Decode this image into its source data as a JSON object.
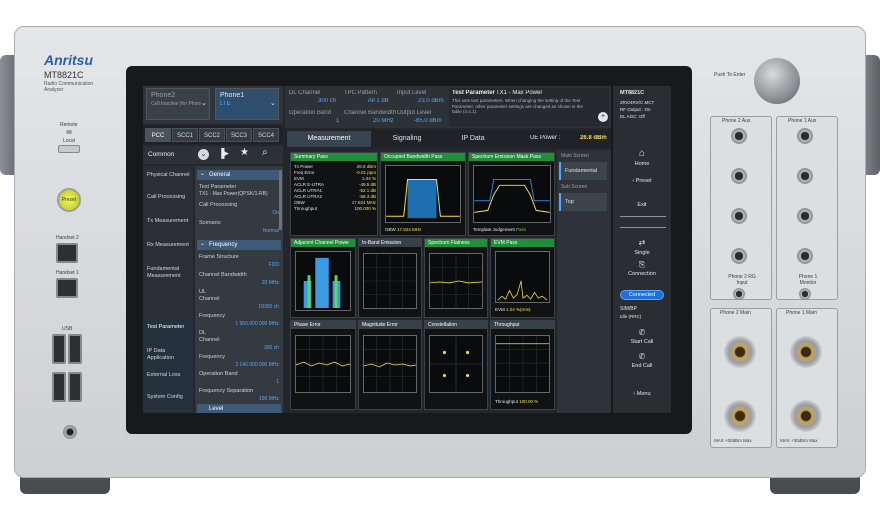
{
  "brand": {
    "logo": "Anritsu",
    "model": "MT8821C",
    "subtitle": "Radio Communication Analyzer"
  },
  "front_left": {
    "remote": "Remote",
    "local": "Local",
    "preset": "Preset",
    "handset2": "Handset 2",
    "handset1": "Handset 1",
    "usb": "USB"
  },
  "phones": {
    "phone2": "Phone2",
    "phone2_sub": "Cell Inactive (for Phone1)",
    "phone1": "Phone1",
    "phone1_sub": "LTE"
  },
  "cc_tabs": [
    "PCC",
    "SCC1",
    "SCC2",
    "SCC3",
    "SCC4"
  ],
  "common_label": "Common",
  "nav": [
    "Physical Channel",
    "Call Processing",
    "Tx Measurement",
    "Rx Measurement",
    "Fundamental Measurement",
    "Test Parameter",
    "IP Data Application",
    "External Loss",
    "System Config"
  ],
  "params": {
    "general": "General",
    "test_param": "Test Parameter",
    "test_param_val": "TX1 - Max Power(QPSK/1-RB)",
    "call_proc": "Call Processing",
    "call_proc_val": "On",
    "scenario": "Scenario",
    "scenario_val": "Normal",
    "frequency": "Frequency",
    "frame": "Frame Structure",
    "frame_val": "FDD",
    "bw": "Channel Bandwidth",
    "bw_val": "20 MHz",
    "ul": "UL",
    "channel": "Channel",
    "ul_ch_val": "18300 ch",
    "ul_freq": "Frequency",
    "ul_freq_val": "1 950.000 000 MHz",
    "dl": "DL",
    "dl_channel": "Channel",
    "dl_ch_val": "300 ch",
    "dl_freq": "Frequency",
    "dl_freq_val": "2 140.000 000 MHz",
    "op_band": "Operation Band",
    "op_band_val": "1",
    "freq_sep": "Frequency Separation",
    "freq_sep_val": "190 MHz",
    "level": "Level"
  },
  "info": {
    "dl_channel": "DL Channel",
    "dl_channel_val": "300 ch",
    "tpc": "TPC Pattern",
    "tpc_val": "All 1 dB",
    "input_level": "Input Level",
    "input_level_val": "23.0 dBm",
    "op_band": "Operation Band",
    "op_band_val": "1",
    "ch_bw": "Channel Bandwidth",
    "ch_bw_val": "20 MHz",
    "out_level": "Output Level",
    "out_level_val": "-85.0 dBm",
    "tp_title": "Test Parameter",
    "tp_val": "TX1 - Max Power",
    "tp_note": "This sets test parameters. When changing the setting of the Test Parameter, other parameter settings are changed as shown in the table (4.4.1)."
  },
  "main_tabs": [
    "Measurement",
    "Signaling",
    "IP Data"
  ],
  "ue_power": {
    "label": "UE Power :",
    "value": "26.8 dBm"
  },
  "panels": [
    {
      "title": "Summary",
      "hdr": "Pass"
    },
    {
      "title": "Occupied Bandwidth",
      "hdr": "Pass"
    },
    {
      "title": "Spectrum Emission Mask",
      "hdr": "Pass"
    },
    {
      "title": "Adjacent Channel Power",
      "hdr": "Pass"
    },
    {
      "title": "In-Band Emission",
      "hdr": ""
    },
    {
      "title": "Spectrum Flatness",
      "hdr": "Pass"
    },
    {
      "title": "EVM",
      "hdr": "Pass"
    },
    {
      "title": "Phase Error",
      "hdr": ""
    },
    {
      "title": "Magnitude Error",
      "hdr": ""
    },
    {
      "title": "Constellation",
      "hdr": ""
    },
    {
      "title": "Throughput",
      "hdr": ""
    }
  ],
  "summary_rows": [
    {
      "k": "Tx Power",
      "v": "26.8",
      "u": "dBm"
    },
    {
      "k": "Freq Error",
      "v": "-0.01",
      "u": "ppm"
    },
    {
      "k": "EVM",
      "v": "1.04",
      "u": "%"
    },
    {
      "k": "ACLR E-UTRA",
      "v": "-49.5",
      "u": "dB"
    },
    {
      "k": "ACLR UTRA1",
      "v": "-52.1",
      "u": "dB"
    },
    {
      "k": "ACLR UTRA2",
      "v": "-58.3",
      "u": "dB"
    },
    {
      "k": "OBW",
      "v": "17.824",
      "u": "MHz"
    },
    {
      "k": "Throughput",
      "v": "100.000",
      "u": "%"
    }
  ],
  "obw_readout": {
    "label": "OBW",
    "value": "17.824 MHz"
  },
  "sem_readout": {
    "label": "Template Judgement",
    "value": "Pass"
  },
  "evm_readout": {
    "label": "EVM",
    "value": "1.04 %(rms)"
  },
  "tput_readout": {
    "label": "Throughput",
    "value": "100.00 %"
  },
  "main_screen": {
    "label": "Main Screen",
    "fundamental": "Fundamental",
    "sub_screen": "Sub Screen",
    "top": "Top"
  },
  "softkeys": {
    "model": "MT8821C",
    "s1": "2RX/4RX/C MCT",
    "s2": "RF Output : On",
    "s3": "DL AGC: Off",
    "home": "Home",
    "preset": "Preset",
    "exit": "Exit",
    "single": "Single",
    "connection": "Connection",
    "connected": "Connected",
    "sim": "SIM/BP",
    "sim_val": "Idle (RRC)",
    "start_call": "Start Call",
    "end_call": "End Call",
    "menu": "Menu"
  },
  "front_right": {
    "push_enter": "Push To Enter",
    "phone2_aux": "Phone 2 Aux",
    "phone1_aux": "Phone 1 Aux",
    "output": "Output",
    "input": "Input",
    "phone2_rg": "Phone 2 RG Input",
    "phone1_mon": "Phone 1 Monitor",
    "phone2_main": "Phone 2 Main",
    "phone1_main": "Phone 1 Main",
    "warn1": "MAX +30dBm Max",
    "warn2": "MAX +30dBm Max"
  }
}
